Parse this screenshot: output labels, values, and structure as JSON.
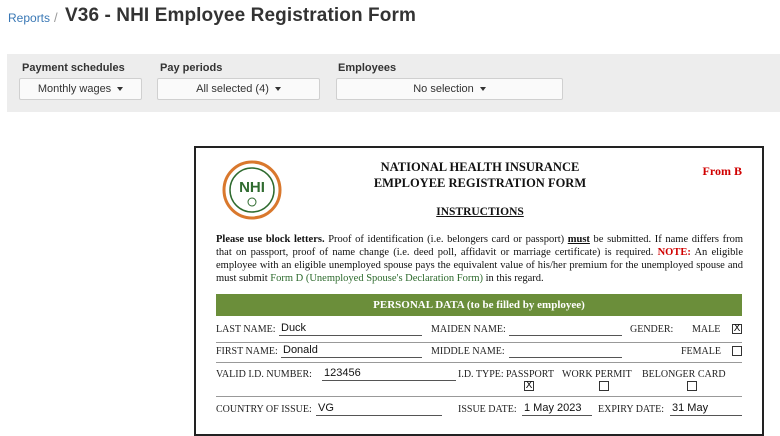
{
  "header": {
    "breadcrumb": "Reports",
    "breadcrumb_sep": "/",
    "title": "V36 - NHI Employee Registration Form"
  },
  "filters": {
    "payment_schedules": {
      "label": "Payment schedules",
      "value": "Monthly wages"
    },
    "pay_periods": {
      "label": "Pay periods",
      "value": "All selected (4)"
    },
    "employees": {
      "label": "Employees",
      "value": "No selection"
    }
  },
  "form": {
    "logo_text": "NHI",
    "title_line1": "NATIONAL HEALTH INSURANCE",
    "title_line2": "EMPLOYEE REGISTRATION FORM",
    "form_code": "From B",
    "instructions_heading": "INSTRUCTIONS",
    "para": {
      "lead": "Please use block letters.",
      "text1": " Proof of identification (i.e. belongers card or passport) ",
      "must": "must",
      "text2": " be submitted. If name differs from that on passport, proof of name change (i.e. deed poll, affidavit or marriage certificate) is required. ",
      "note": "NOTE:",
      "text3": " An eligible employee with an eligible unemployed spouse pays the equivalent value of his/her premium for the unemployed spouse and must submit ",
      "form_d": "Form D (Unemployed Spouse's Declaration Form)",
      "text4": " in this regard."
    },
    "section_title": "PERSONAL DATA (to be filled by employee)",
    "fields": {
      "last_name_label": "LAST NAME:",
      "last_name_value": "Duck",
      "maiden_name_label": "MAIDEN NAME:",
      "maiden_name_value": "",
      "gender_label": "GENDER:",
      "male_label": "MALE",
      "male_checked": "X",
      "first_name_label": "FIRST NAME:",
      "first_name_value": "Donald",
      "middle_name_label": "MIDDLE NAME:",
      "middle_name_value": "",
      "female_label": "FEMALE",
      "female_checked": "",
      "valid_id_label": "VALID I.D. NUMBER:",
      "valid_id_value": "123456",
      "id_type_label": "I.D. TYPE:",
      "passport_label": "PASSPORT",
      "passport_checked": "X",
      "work_permit_label": "WORK PERMIT",
      "work_permit_checked": "",
      "belonger_label": "BELONGER CARD",
      "belonger_checked": "",
      "country_label": "COUNTRY OF ISSUE:",
      "country_value": "VG",
      "issue_date_label": "ISSUE DATE:",
      "issue_date_value": "1 May 2023",
      "expiry_date_label": "EXPIRY DATE:",
      "expiry_date_value": "31 May"
    }
  },
  "colors": {
    "link": "#3a78b5",
    "section_green": "#6b8e3a",
    "note_red": "#d00000",
    "logo_green": "#2f6b2f",
    "logo_orange": "#d9782d"
  }
}
